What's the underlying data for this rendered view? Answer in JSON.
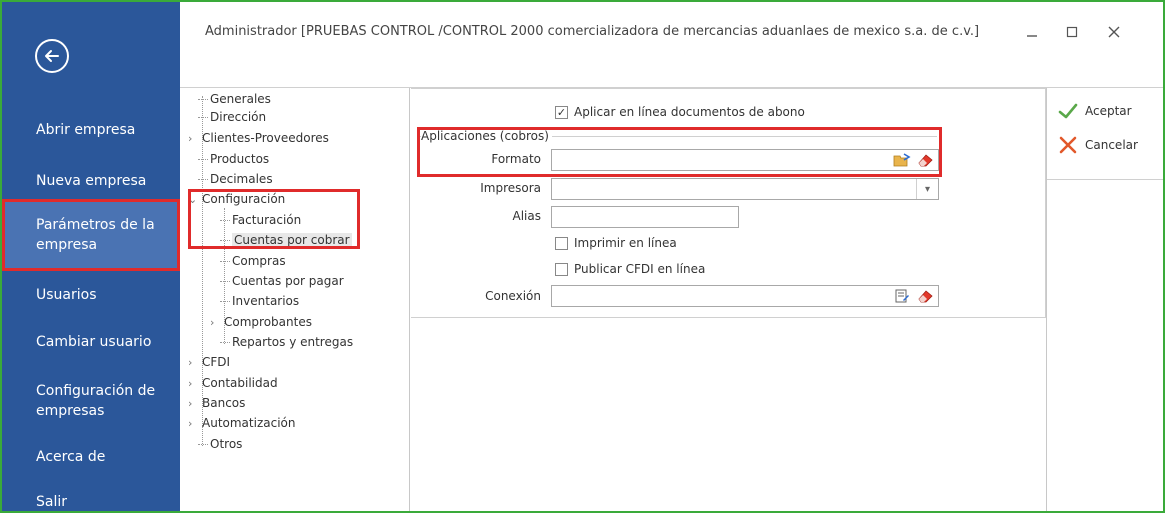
{
  "window": {
    "title": "Administrador [PRUEBAS CONTROL  /CONTROL 2000 comercializadora de mercancias aduanlaes de mexico s.a. de c.v.]",
    "minimize_icon": "minimize-icon",
    "maximize_icon": "maximize-icon",
    "close_icon": "close-icon"
  },
  "sidebar": {
    "back_icon": "back-arrow-icon",
    "items": [
      {
        "label": "Abrir empresa"
      },
      {
        "label": "Nueva empresa"
      },
      {
        "label": "Parámetros de la empresa",
        "line1": "Parámetros de la",
        "line2": "empresa"
      },
      {
        "label": "Usuarios"
      },
      {
        "label": "Cambiar usuario"
      },
      {
        "label": "Configuración de empresas",
        "line1": "Configuración de",
        "line2": "empresas"
      },
      {
        "label": "Acerca de"
      },
      {
        "label": "Salir"
      }
    ]
  },
  "tree": {
    "nodes": [
      {
        "label": "Generales"
      },
      {
        "label": "Dirección"
      },
      {
        "label": "Clientes-Proveedores"
      },
      {
        "label": "Productos"
      },
      {
        "label": "Decimales"
      },
      {
        "label": "Configuración"
      },
      {
        "label": "Facturación"
      },
      {
        "label": "Cuentas por cobrar"
      },
      {
        "label": "Compras"
      },
      {
        "label": "Cuentas por pagar"
      },
      {
        "label": "Inventarios"
      },
      {
        "label": "Comprobantes"
      },
      {
        "label": "Repartos y entregas"
      },
      {
        "label": "CFDI"
      },
      {
        "label": "Contabilidad"
      },
      {
        "label": "Bancos"
      },
      {
        "label": "Automatización"
      },
      {
        "label": "Otros"
      }
    ],
    "selected": "Cuentas por cobrar"
  },
  "form": {
    "apply_online_label": "Aplicar en línea documentos de abono",
    "apply_online_checked": true,
    "group_title": "Aplicaciones (cobros)",
    "formato_label": "Formato",
    "formato_value": "",
    "impresora_label": "Impresora",
    "impresora_value": "",
    "alias_label": "Alias",
    "alias_value": "",
    "print_online_label": "Imprimir en línea",
    "print_online_checked": false,
    "publish_cfdi_label": "Publicar CFDI en línea",
    "publish_cfdi_checked": false,
    "conexion_label": "Conexión",
    "conexion_value": ""
  },
  "actions": {
    "accept_label": "Aceptar",
    "cancel_label": "Cancelar"
  },
  "colors": {
    "sidebar_bg": "#2b579a",
    "highlight_red": "#e02b2b",
    "frame_green": "#3aaa3a",
    "accept_green": "#5aa84a",
    "cancel_orange": "#e2582a"
  }
}
